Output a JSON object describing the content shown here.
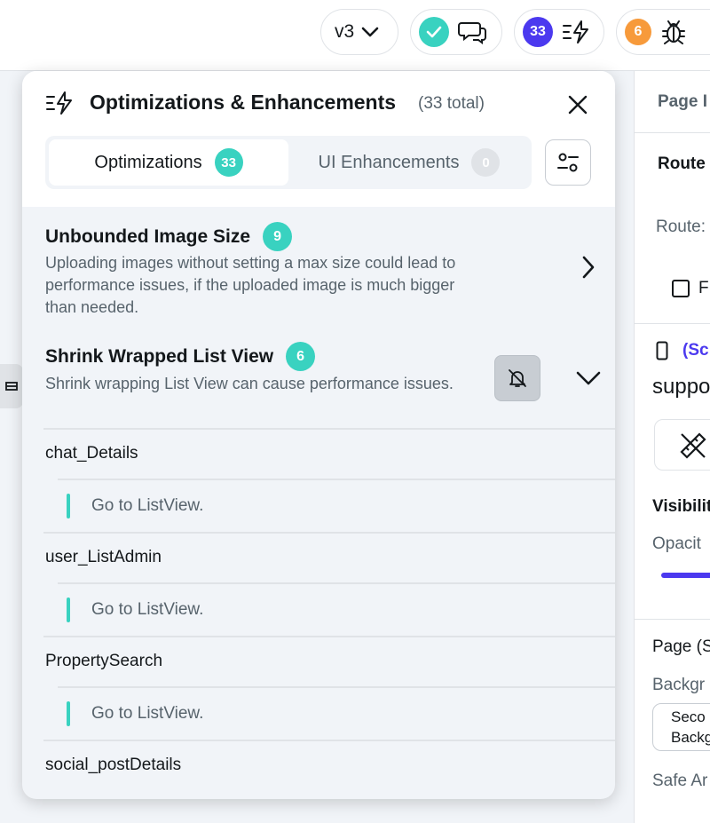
{
  "toolbar": {
    "version_label": "v3",
    "comments_icon": "check-icon",
    "optimizations_count": "33",
    "bugs_count": "6"
  },
  "popover": {
    "title": "Optimizations & Enhancements",
    "total": "(33 total)",
    "tabs": [
      {
        "label": "Optimizations",
        "count": "33"
      },
      {
        "label": "UI Enhancements",
        "count": "0"
      }
    ],
    "sections": [
      {
        "title": "Unbounded Image Size",
        "count": "9",
        "description": "Uploading images without setting a max size could lead to performance issues, if the uploaded image is much bigger than needed."
      },
      {
        "title": "Shrink Wrapped List View",
        "count": "6",
        "description": "Shrink wrapping List View can cause performance issues."
      }
    ],
    "items": [
      {
        "name": "chat_Details",
        "action": "Go to ListView."
      },
      {
        "name": "user_ListAdmin",
        "action": "Go to ListView."
      },
      {
        "name": "PropertySearch",
        "action": "Go to ListView."
      },
      {
        "name": "social_postDetails"
      }
    ]
  },
  "right_panel": {
    "header": "Page I",
    "route_title": "Route",
    "route_label": "Route:",
    "checkbox_label": "F",
    "screen_tag": "(Sc",
    "support_text": "suppo",
    "visibility_label": "Visibilit",
    "opacity_label": "Opacit",
    "page_label": "Page (S",
    "background_label": "Backgr",
    "color_value_1": "Seco",
    "color_value_2": "Backg",
    "safe_area_label": "Safe Ar"
  },
  "colors": {
    "accent_teal": "#39d2c0",
    "accent_purple": "#4b39ef",
    "accent_orange": "#f79a3b"
  }
}
